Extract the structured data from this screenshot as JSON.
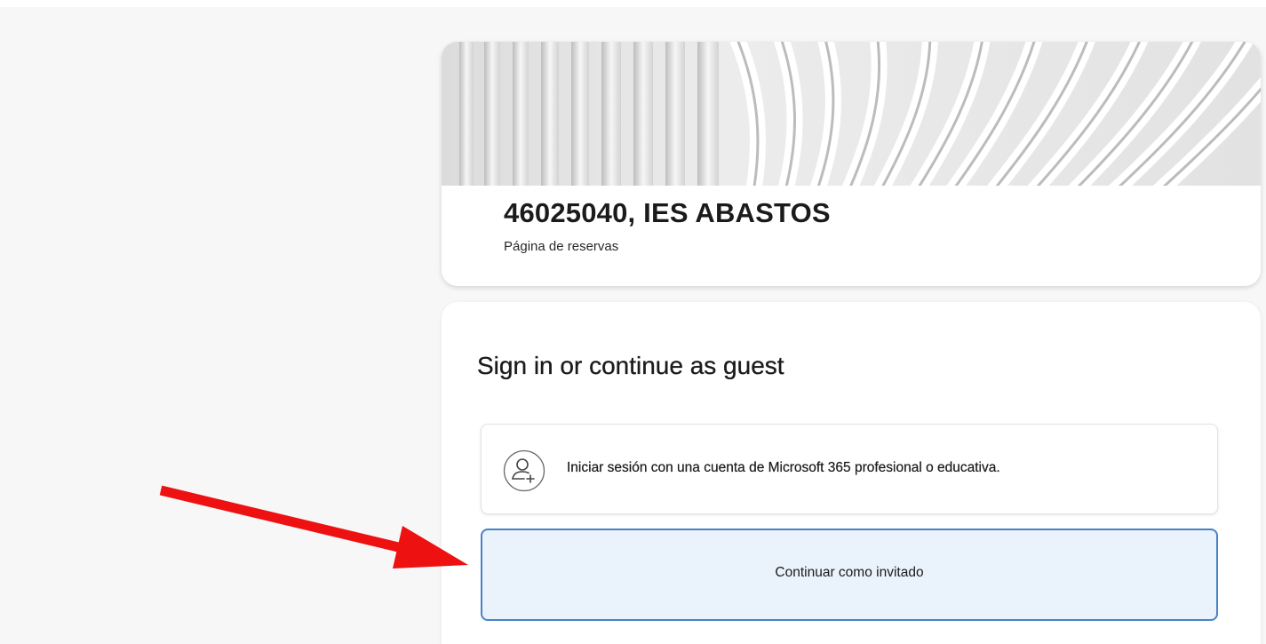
{
  "header": {
    "business_name": "46025040, IES ABASTOS",
    "subtitle": "Página de reservas"
  },
  "signin": {
    "title": "Sign in or continue as guest",
    "microsoft_option_label": "Iniciar sesión con una cuenta de Microsoft 365 profesional o educativa.",
    "guest_option_label": "Continuar como invitado"
  },
  "icons": {
    "microsoft_option_icon": "person-add-icon"
  },
  "colors": {
    "guest_button_background": "#eaf2fc",
    "guest_button_border": "#4a83c4",
    "annotation_arrow": "#ee1111"
  }
}
